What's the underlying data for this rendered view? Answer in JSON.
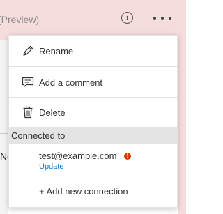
{
  "header": {
    "title": "(Preview)",
    "info_glyph": "i",
    "background_color": "#f6dcdc"
  },
  "menu": {
    "items": [
      {
        "label": "Rename",
        "icon": "pencil-icon"
      },
      {
        "label": "Add a comment",
        "icon": "comment-icon"
      },
      {
        "label": "Delete",
        "icon": "trash-icon"
      }
    ],
    "connected_section": {
      "header": "Connected to",
      "connection": {
        "email": "test@example.com",
        "status_icon": "warning-icon",
        "status_color": "#d83b01",
        "action_label": "Update",
        "action_color": "#0078d4"
      }
    },
    "add_connection_label": "+ Add new connection"
  },
  "background": {
    "partial_text": "No"
  }
}
